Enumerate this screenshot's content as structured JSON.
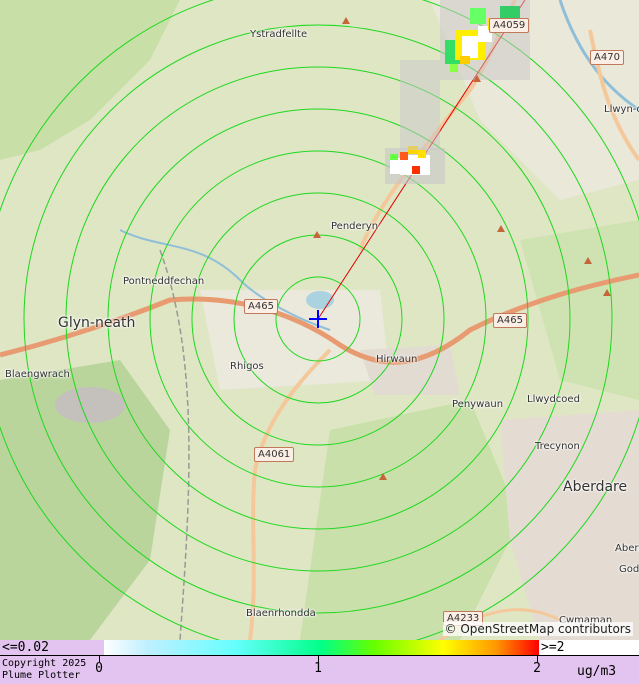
{
  "map": {
    "places": [
      {
        "name": "Ystradfellte",
        "kind": "village"
      },
      {
        "name": "Penderyn",
        "kind": "village"
      },
      {
        "name": "Pontneddfechan",
        "kind": "village"
      },
      {
        "name": "Glyn-neath",
        "kind": "town"
      },
      {
        "name": "Rhigos",
        "kind": "village"
      },
      {
        "name": "Hirwaun",
        "kind": "village"
      },
      {
        "name": "Blaengwrach",
        "kind": "village"
      },
      {
        "name": "Penywaun",
        "kind": "village"
      },
      {
        "name": "Llwydcoed",
        "kind": "village"
      },
      {
        "name": "Trecynon",
        "kind": "village"
      },
      {
        "name": "Aberdare",
        "kind": "town"
      },
      {
        "name": "Blaenrhondda",
        "kind": "village"
      },
      {
        "name": "Cwmaman",
        "kind": "village"
      },
      {
        "name": "Llwyn-c",
        "kind": "village"
      },
      {
        "name": "Abera",
        "kind": "village"
      },
      {
        "name": "God",
        "kind": "village"
      }
    ],
    "roads": [
      "A465",
      "A465",
      "A4061",
      "A4059",
      "A470",
      "A4233"
    ],
    "attribution": "© OpenStreetMap contributors",
    "source_marker": "source-cross",
    "colors": {
      "rings": "#1ed81e",
      "plume_line": "#e00000",
      "source": "#0000ff"
    }
  },
  "legend": {
    "min_label": "<=0.02",
    "max_label": ">=2",
    "ticks": [
      "0",
      "1",
      "2"
    ],
    "units": "ug/m3",
    "copyright_line1": "Copyright 2025",
    "copyright_line2": "Plume Plotter",
    "gradient": [
      "#ffffff",
      "#bfefff",
      "#66ffff",
      "#00ff88",
      "#66ff00",
      "#ffff00",
      "#ff9900",
      "#ff0000"
    ]
  }
}
